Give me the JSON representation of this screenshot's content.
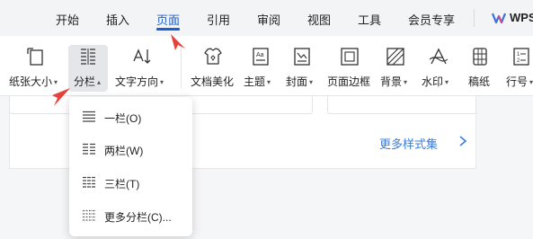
{
  "tabs": [
    {
      "id": "start",
      "label": "开始"
    },
    {
      "id": "insert",
      "label": "插入"
    },
    {
      "id": "page",
      "label": "页面"
    },
    {
      "id": "ref",
      "label": "引用"
    },
    {
      "id": "review",
      "label": "审阅"
    },
    {
      "id": "view",
      "label": "视图"
    },
    {
      "id": "tools",
      "label": "工具"
    },
    {
      "id": "member",
      "label": "会员专享"
    }
  ],
  "active_tab": "页面",
  "wps_label": "WPS",
  "ribbon": {
    "paper_size": "纸张大小",
    "columns": "分栏",
    "text_direction": "文字方向",
    "doc_beautify": "文档美化",
    "theme": "主题",
    "cover": "封面",
    "page_border": "页面边框",
    "background": "背景",
    "watermark": "水印",
    "manuscript": "稿纸",
    "line_number": "行号"
  },
  "more_styles": "更多样式集",
  "columns_menu": {
    "one": "一栏(O)",
    "two": "两栏(W)",
    "three": "三栏(T)",
    "more": "更多分栏(C)..."
  },
  "colors": {
    "accent": "#1a5fd6",
    "link": "#3d7ad6",
    "annotation_arrow": "#e8413a"
  },
  "icons": [
    "paper-size-icon",
    "columns-icon",
    "text-direction-icon",
    "doc-beautify-icon",
    "theme-icon",
    "cover-icon",
    "page-border-icon",
    "background-icon",
    "watermark-icon",
    "manuscript-icon",
    "line-number-icon",
    "wps-logo-icon",
    "chevron-right-icon"
  ]
}
